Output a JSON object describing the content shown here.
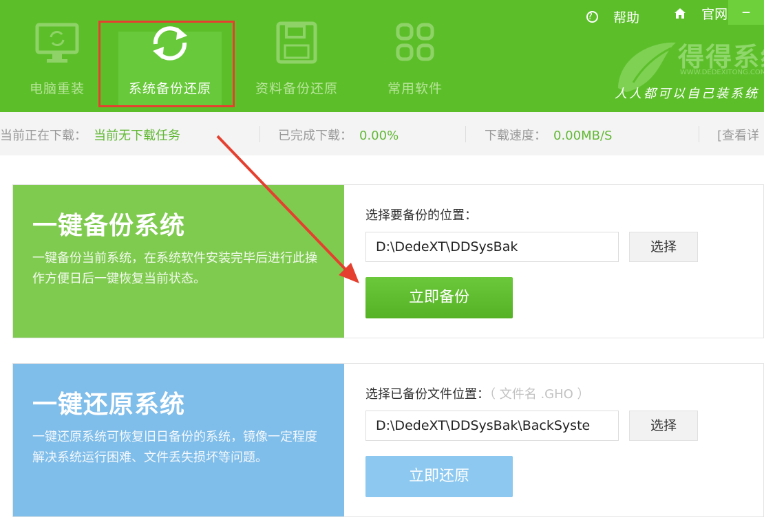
{
  "colors": {
    "header_green": "#5cbf2a",
    "backup_green": "#7fcb4f",
    "restore_blue": "#7fbdea",
    "highlight_red": "#e5402f",
    "status_value_green": "#62b835"
  },
  "header": {
    "nav": [
      {
        "label": "电脑重装",
        "icon": "monitor-refresh-icon",
        "active": false
      },
      {
        "label": "系统备份还原",
        "icon": "sync-icon",
        "active": true
      },
      {
        "label": "资料备份还原",
        "icon": "floppy-disk-icon",
        "active": false
      },
      {
        "label": "常用软件",
        "icon": "grid-apps-icon",
        "active": false
      }
    ],
    "help_label": "帮助",
    "site_label": "官网",
    "minimize_label": "–",
    "brand_text": "得得系统",
    "brand_url": "WWW.DEDEXITONG.COM",
    "slogan": "人人都可以自己装系统"
  },
  "status": {
    "downloading_label": "当前正在下载：",
    "downloading_value": "当前无下载任务",
    "completed_label": "已完成下载：",
    "completed_value": "0.00%",
    "speed_label": "下载速度：",
    "speed_value": "0.00MB/S",
    "details_link": "[查看详"
  },
  "backup": {
    "title": "一键备份系统",
    "desc": "一键备份当前系统，在系统软件安装完毕后进行此操作方便日后一键恢复当前状态。",
    "field_label": "选择要备份的位置：",
    "path": "D:\\DedeXT\\DDSysBak",
    "choose_label": "选择",
    "action_label": "立即备份"
  },
  "restore": {
    "title": "一键还原系统",
    "desc": "一键还原系统可恢复旧日备份的系统，镜像一定程度解决系统运行困难、文件丢失损坏等问题。",
    "field_label": "选择已备份文件位置：",
    "field_hint": "（ 文件名 .GHO ）",
    "path": "D:\\DedeXT\\DDSysBak\\BackSyste",
    "choose_label": "选择",
    "action_label": "立即还原"
  }
}
